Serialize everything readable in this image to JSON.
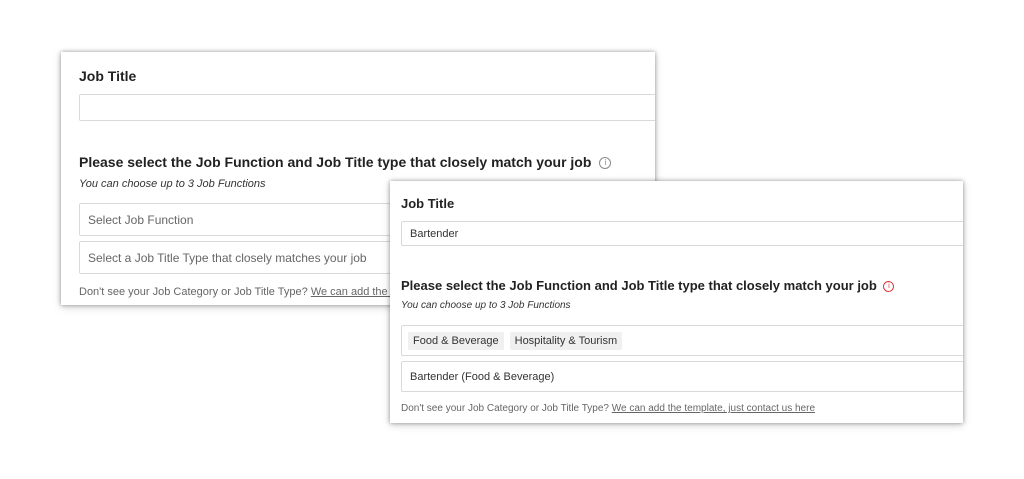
{
  "back_card": {
    "job_title_label": "Job Title",
    "job_title_value": "",
    "section_title": "Please select the Job Function and Job Title type that closely match your job",
    "info_icon": "info-circle-icon",
    "hint": "You can choose up to 3 Job Functions",
    "function_placeholder": "Select Job Function",
    "title_type_placeholder": "Select a Job Title Type that closely matches your job",
    "footnote_text": "Don't see your Job Category or Job Title Type? ",
    "footnote_link": "We can add the template, just contact us here"
  },
  "front_card": {
    "job_title_label": "Job Title",
    "job_title_value": "Bartender",
    "section_title": "Please select the Job Function and Job Title type that closely match your job",
    "info_icon": "info-circle-icon",
    "info_icon_color": "#e03a3a",
    "hint": "You can choose up to 3 Job Functions",
    "selected_functions": [
      "Food & Beverage",
      "Hospitality & Tourism"
    ],
    "selected_title_type": "Bartender (Food & Beverage)",
    "footnote_text": "Don't see your Job Category or Job Title Type? ",
    "footnote_link": "We can add the template, just contact us here"
  }
}
